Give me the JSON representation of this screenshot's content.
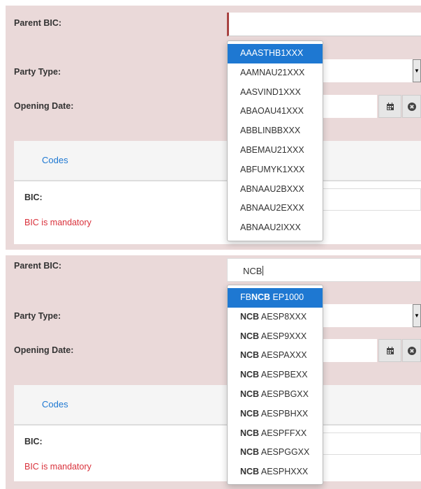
{
  "panel1": {
    "labels": {
      "parent_bic": "Parent BIC:",
      "party_type": "Party Type:",
      "opening_date": "Opening Date:"
    },
    "parent_bic_value": "",
    "tab_label": "Codes",
    "bic_label": "BIC:",
    "bic_error": "BIC is mandatory",
    "dropdown": [
      {
        "text": "AAASTHB1XXX",
        "active": true
      },
      {
        "text": "AAMNAU21XXX"
      },
      {
        "text": "AASVIND1XXX"
      },
      {
        "text": "ABAOAU41XXX"
      },
      {
        "text": "ABBLINBBXXX"
      },
      {
        "text": "ABEMAU21XXX"
      },
      {
        "text": "ABFUMYK1XXX"
      },
      {
        "text": "ABNAAU2BXXX"
      },
      {
        "text": "ABNAAU2EXXX"
      },
      {
        "text": "ABNAAU2IXXX"
      }
    ]
  },
  "panel2": {
    "labels": {
      "parent_bic": "Parent BIC:",
      "party_type": "Party Type:",
      "opening_date": "Opening Date:"
    },
    "parent_bic_value": "NCB",
    "tab_label": "Codes",
    "bic_label": "BIC:",
    "bic_error": "BIC is mandatory",
    "dropdown": [
      {
        "pre": "FB",
        "match": "NCB",
        "post": " EP1000",
        "active": true
      },
      {
        "pre": "",
        "match": "NCB",
        "post": " AESP8XXX"
      },
      {
        "pre": "",
        "match": "NCB",
        "post": " AESP9XXX"
      },
      {
        "pre": "",
        "match": "NCB",
        "post": " AESPAXXX"
      },
      {
        "pre": "",
        "match": "NCB",
        "post": " AESPBEXX"
      },
      {
        "pre": "",
        "match": "NCB",
        "post": " AESPBGXX"
      },
      {
        "pre": "",
        "match": "NCB",
        "post": " AESPBHXX"
      },
      {
        "pre": "",
        "match": "NCB",
        "post": " AESPFFXX"
      },
      {
        "pre": "",
        "match": "NCB",
        "post": " AESPGGXX"
      },
      {
        "pre": "",
        "match": "NCB",
        "post": " AESPHXXX"
      }
    ]
  },
  "icons": {
    "select_arrow": "select-arrow-icon",
    "calendar": "calendar-icon",
    "clear": "times-circle-icon"
  },
  "colors": {
    "panel_bg": "#ead9d9",
    "link": "#1e78d2",
    "error": "#d9313b",
    "active_item": "#1e78d2",
    "required_bar": "#a94442"
  }
}
